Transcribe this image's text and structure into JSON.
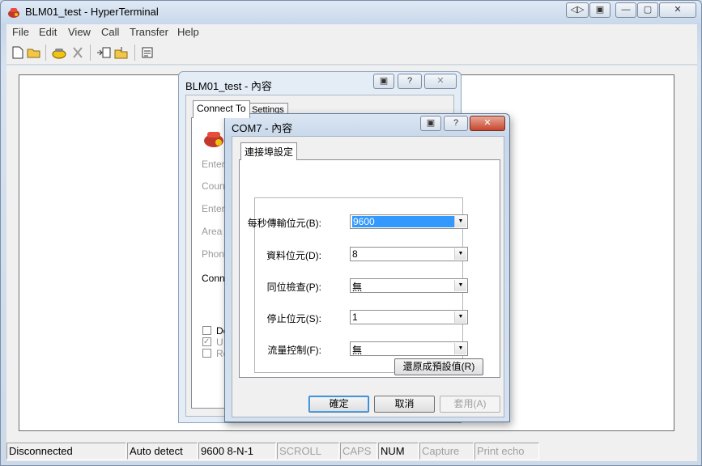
{
  "window": {
    "title": "BLM01_test - HyperTerminal",
    "controls": [
      "◁▷",
      "▣",
      "—",
      "▢",
      "✕"
    ]
  },
  "menu": [
    "File",
    "Edit",
    "View",
    "Call",
    "Transfer",
    "Help"
  ],
  "status": {
    "connection": "Disconnected",
    "detect": "Auto detect",
    "params": "9600 8-N-1",
    "scroll": "SCROLL",
    "caps": "CAPS",
    "num": "NUM",
    "capture": "Capture",
    "print_echo": "Print echo"
  },
  "dialog1": {
    "title": "BLM01_test - 內容",
    "tab_connect": "Connect To",
    "tab_settings": "Settings",
    "ghost_labels": [
      "Enter",
      "Count",
      "Enter",
      "Area c",
      "Phone",
      "Conne"
    ],
    "ghost_checks": [
      "De",
      "U",
      "Re"
    ]
  },
  "dialog2": {
    "title": "COM7 - 內容",
    "tab": "連接埠設定",
    "fields": [
      {
        "label": "每秒傳輸位元(B):",
        "value": "9600"
      },
      {
        "label": "資料位元(D):",
        "value": "8"
      },
      {
        "label": "同位檢查(P):",
        "value": "無"
      },
      {
        "label": "停止位元(S):",
        "value": "1"
      },
      {
        "label": "流量控制(F):",
        "value": "無"
      }
    ],
    "restore_button": "還原成預設值(R)",
    "ok": "確定",
    "cancel": "取消",
    "apply": "套用(A)"
  }
}
